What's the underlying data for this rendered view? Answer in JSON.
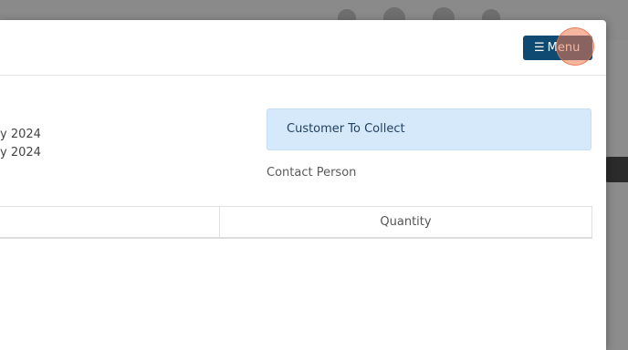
{
  "header": {
    "menu_icon": "hamburger-icon",
    "menu_glyph": "☰",
    "menu_label": "Menu"
  },
  "details": {
    "date_line_1": "y 2024",
    "date_line_2": "y 2024"
  },
  "collection": {
    "alert_text": "Customer To Collect",
    "contact_label": "Contact Person"
  },
  "table": {
    "columns": [
      "",
      "Quantity"
    ]
  },
  "colors": {
    "menu_button": "#0f4a73",
    "alert_bg": "#d6e9fb",
    "click_marker": "#ee7850"
  }
}
